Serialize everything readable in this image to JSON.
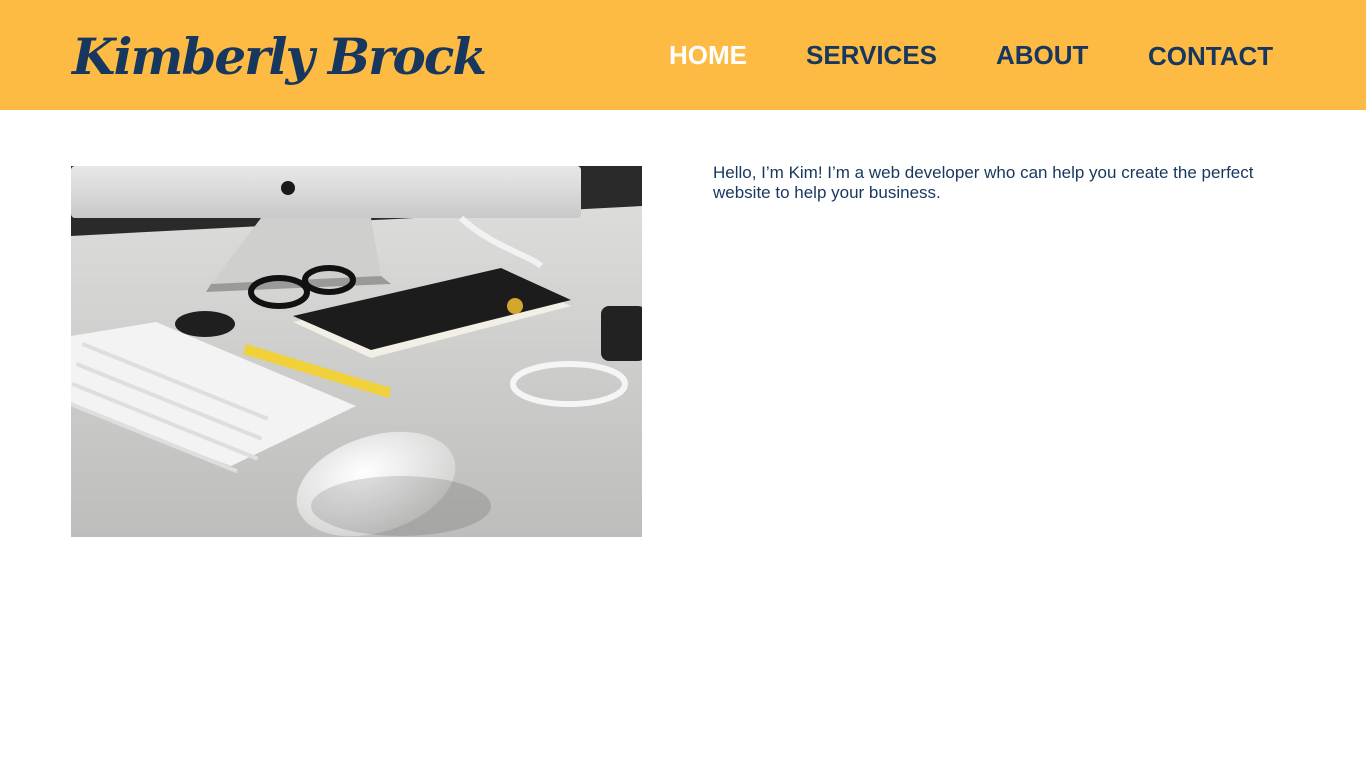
{
  "header": {
    "logo_text": "Kimberly Brock",
    "nav": [
      {
        "label": "HOME",
        "active": true
      },
      {
        "label": "SERVICES",
        "active": false
      },
      {
        "label": "ABOUT",
        "active": false
      },
      {
        "label": "CONTACT",
        "active": false
      }
    ]
  },
  "main": {
    "intro": "Hello, I’m Kim! I’m a web developer who can help you create the perfect website to help your business."
  },
  "colors": {
    "header_bg": "#fdbb43",
    "brand_navy": "#17375e",
    "active_nav": "#ffffff"
  }
}
